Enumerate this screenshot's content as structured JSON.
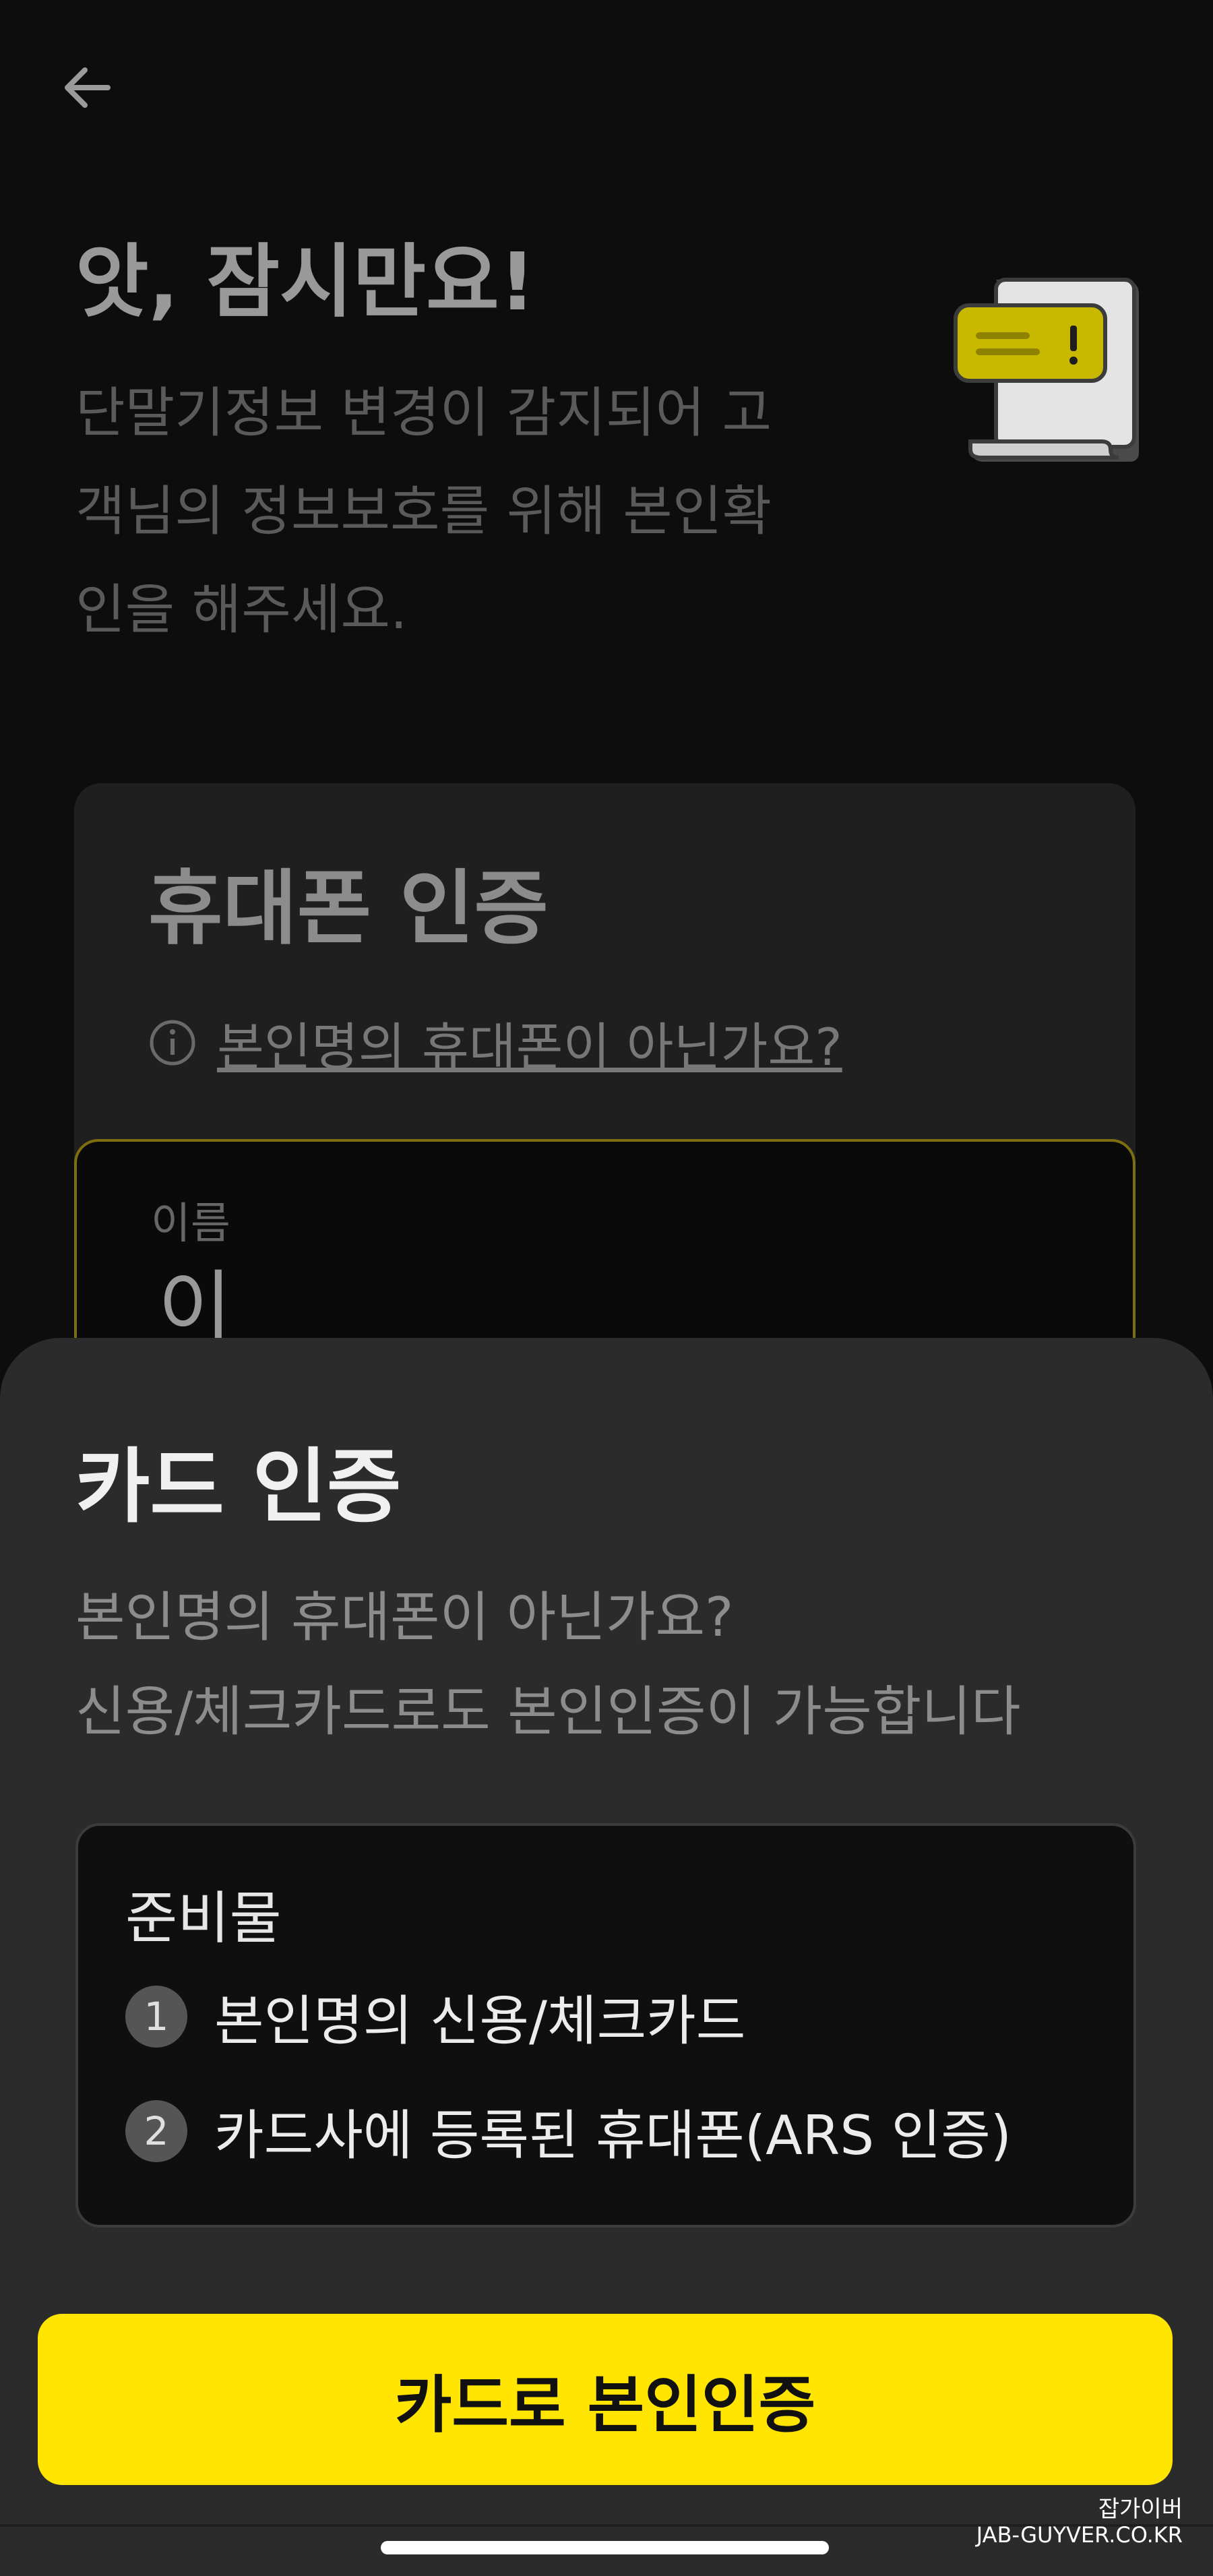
{
  "header": {
    "back_icon": "arrow-left-icon",
    "title": "앗, 잠시만요!",
    "description_lines": [
      "단말기정보 변경이 감지되어 고",
      "객님의 정보보호를 위해 본인확",
      "인을 해주세요."
    ],
    "illustration": "warning-document-icon"
  },
  "phone_verification": {
    "title": "휴대폰 인증",
    "info_icon": "info-icon",
    "link_text": "본인명의 휴대폰이 아닌가요?"
  },
  "name_field": {
    "label": "이름",
    "value": "이"
  },
  "card_sheet": {
    "title": "카드 인증",
    "description_lines": [
      "본인명의 휴대폰이 아닌가요?",
      "신용/체크카드로도 본인인증이 가능합니다"
    ],
    "prep_title": "준비물",
    "prep_items": [
      {
        "num": "1",
        "text": "본인명의 신용/체크카드"
      },
      {
        "num": "2",
        "text": "카드사에 등록된 휴대폰(ARS 인증)"
      }
    ],
    "cta_label": "카드로 본인인증"
  },
  "watermark": {
    "korean": "잡가이버",
    "english": "JAB-GUYVER.CO.KR"
  },
  "colors": {
    "accent": "#ffe500",
    "background": "#0d0d0d",
    "sheet": "#2b2b2b"
  }
}
